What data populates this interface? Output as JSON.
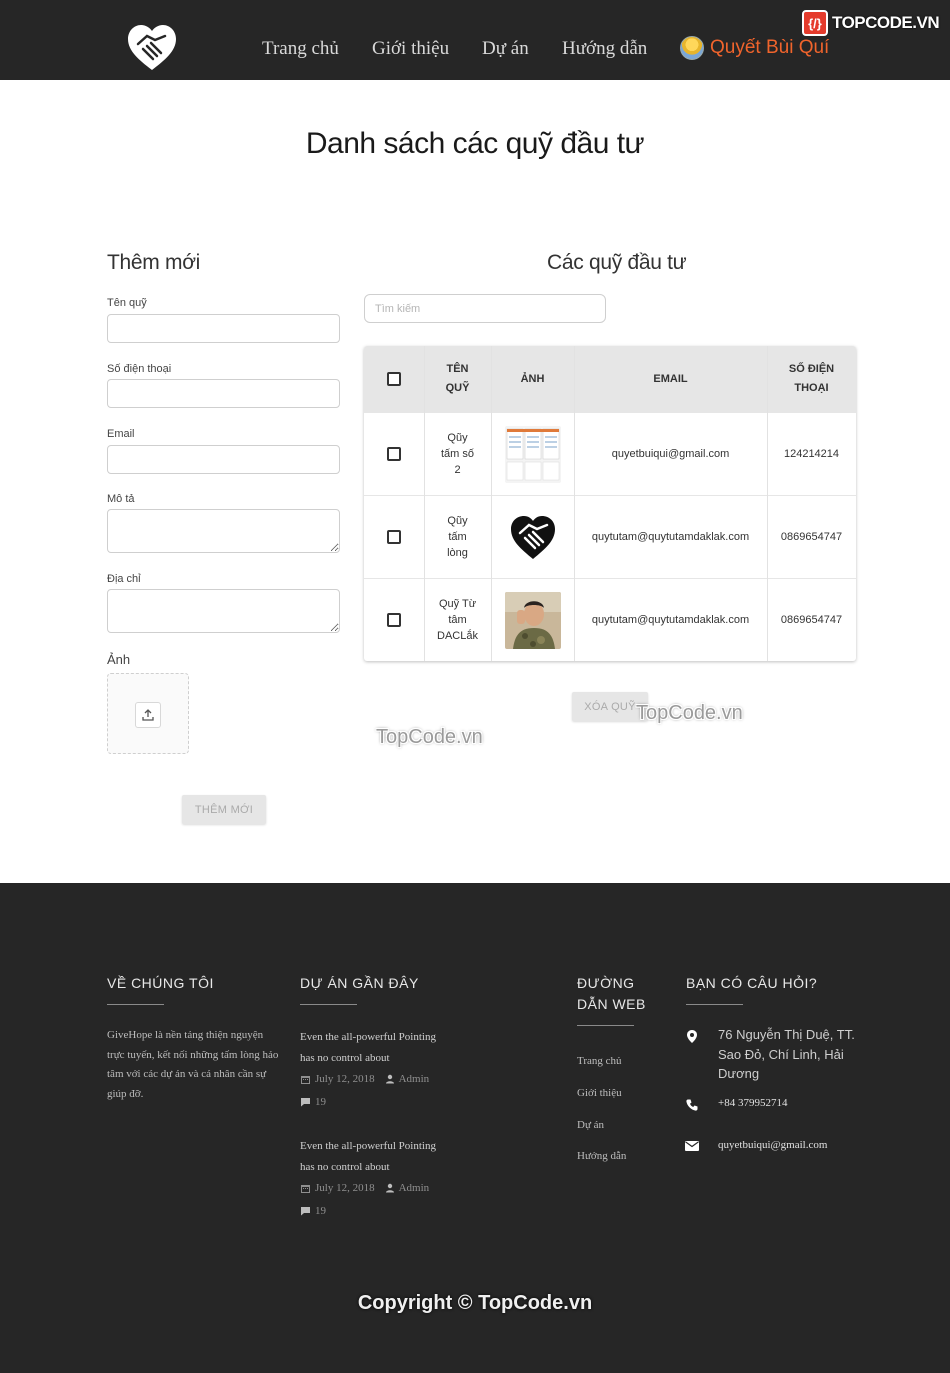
{
  "header": {
    "nav": [
      {
        "label": "Trang chủ"
      },
      {
        "label": "Giới thiệu"
      },
      {
        "label": "Dự án"
      },
      {
        "label": "Hướng dẫn"
      }
    ],
    "user_name": "Quyết Bùi Quí",
    "watermark": "TOPCODE.VN",
    "logo_icon": "handshake-heart-icon",
    "avatar_icon": "minion-avatar"
  },
  "page": {
    "title": "Danh sách các quỹ đầu tư"
  },
  "form": {
    "title": "Thêm mới",
    "fields": {
      "name": {
        "label": "Tên quỹ",
        "value": ""
      },
      "phone": {
        "label": "Số điện thoại",
        "value": ""
      },
      "email": {
        "label": "Email",
        "value": ""
      },
      "description": {
        "label": "Mô tả",
        "value": ""
      },
      "address": {
        "label": "Địa chỉ",
        "value": ""
      }
    },
    "image_label": "Ảnh",
    "upload_icon": "upload-icon",
    "submit_label": "THÊM MỚI"
  },
  "list": {
    "title": "Các quỹ đầu tư",
    "search_placeholder": "Tìm kiếm",
    "columns": [
      "TÊN QUỸ",
      "ẢNH",
      "EMAIL",
      "SỐ ĐIỆN THOẠI"
    ],
    "rows": [
      {
        "name": "Qũy tấm số 2",
        "image": "document-thumbnail",
        "email": "quyetbuiqui@gmail.com",
        "phone": "124214214",
        "checked": false
      },
      {
        "name": "Qũy tấm lòng",
        "image": "handshake-heart-thumbnail",
        "email": "quytutam@quytutamdaklak.com",
        "phone": "0869654747",
        "checked": false
      },
      {
        "name": "Quỹ Từ tâm DACLắk",
        "image": "soldier-photo-thumbnail",
        "email": "quytutam@quytutamdaklak.com",
        "phone": "0869654747",
        "checked": false
      }
    ],
    "delete_label": "XÓA QUỸ"
  },
  "watermarks": [
    "TopCode.vn",
    "TopCode.vn"
  ],
  "footer": {
    "about": {
      "title": "VỀ CHÚNG TÔI",
      "text": "GiveHope là nền tảng thiện nguyện trực tuyến, kết nối những tấm lòng hảo tâm với các dự án và cá nhân cần sự giúp đỡ."
    },
    "projects": {
      "title": "DỰ ÁN GẦN ĐÂY",
      "posts": [
        {
          "title": "Even the all-powerful Pointing has no control about",
          "date": "July 12, 2018",
          "author": "Admin",
          "comments": "19"
        },
        {
          "title": "Even the all-powerful Pointing has no control about",
          "date": "July 12, 2018",
          "author": "Admin",
          "comments": "19"
        }
      ]
    },
    "guide": {
      "title": "ĐƯỜNG DẪN WEB",
      "links": [
        "Trang chủ",
        "Giới thiệu",
        "Dự án",
        "Hướng dẫn"
      ]
    },
    "contact": {
      "title": "BẠN CÓ CÂU HỎI?",
      "address": "76 Nguyễn Thị Duệ, TT. Sao Đỏ, Chí Linh, Hải Dương",
      "phone": "+84 379952714",
      "email": "quyetbuiqui@gmail.com"
    },
    "copyright": "Copyright © TopCode.vn"
  },
  "colors": {
    "header_bg": "#262626",
    "footer_bg": "#262626",
    "user_accent": "#f0642c",
    "table_head_bg": "#e6e6e6"
  }
}
